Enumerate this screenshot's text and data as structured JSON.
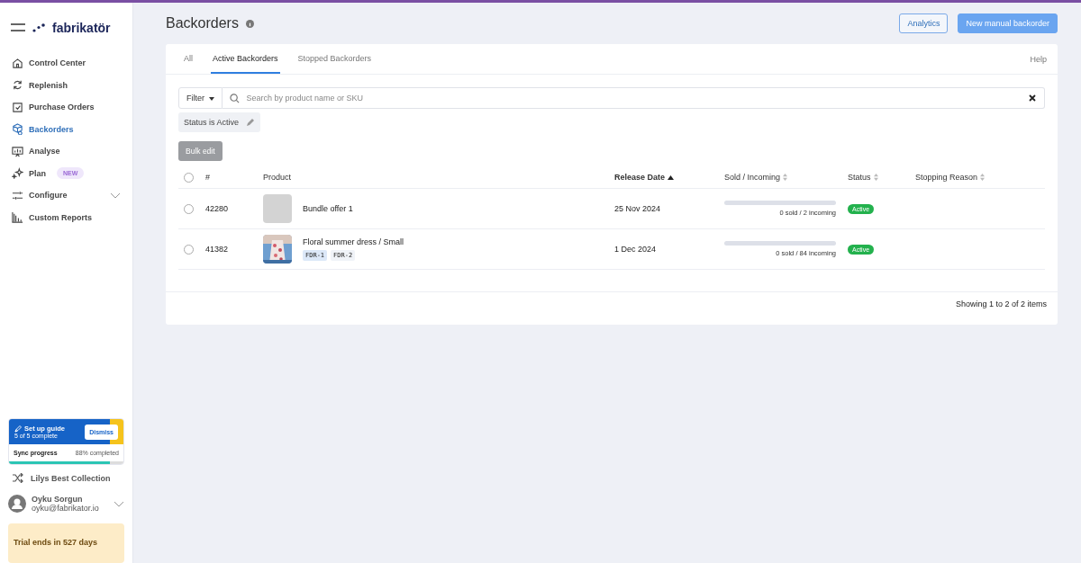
{
  "brand": {
    "name": "fabrikatör"
  },
  "nav": [
    {
      "label": "Control Center",
      "selected": false
    },
    {
      "label": "Replenish",
      "selected": false
    },
    {
      "label": "Purchase Orders",
      "selected": false
    },
    {
      "label": "Backorders",
      "selected": true
    },
    {
      "label": "Analyse",
      "selected": false
    },
    {
      "label": "Plan",
      "selected": false,
      "badge": "NEW"
    },
    {
      "label": "Configure",
      "selected": false,
      "expandable": true
    },
    {
      "label": "Custom Reports",
      "selected": false
    }
  ],
  "setup": {
    "title": "Set up guide",
    "subtitle": "5 of 5 complete",
    "dismiss": "Dismiss",
    "sync_label": "Sync progress",
    "sync_reading": "88% completed",
    "level": 0.88
  },
  "store": {
    "name": "Lilys Best Collection"
  },
  "user": {
    "name": "Oyku Sorgun",
    "email": "oyku@fabrikator.io"
  },
  "trial": {
    "text": "Trial ends in 527 days"
  },
  "page": {
    "title": "Backorders",
    "buttons": [
      {
        "label": "Analytics",
        "kind": "outline"
      },
      {
        "label": "New manual backorder",
        "kind": "primary"
      }
    ]
  },
  "tabs": [
    {
      "label": "All",
      "selected": false
    },
    {
      "label": "Active Backorders",
      "selected": true
    },
    {
      "label": "Stopped Backorders",
      "selected": false
    }
  ],
  "help": "Help",
  "filter": {
    "label": "Filter",
    "placeholder": "Search by product name or SKU",
    "chips": [
      "Status is Active"
    ]
  },
  "bulk_edit": {
    "label": "Bulk edit",
    "disabled": true
  },
  "table": {
    "all_checked": false,
    "columns": [
      {
        "label": "#",
        "kind": "plain"
      },
      {
        "label": "Product",
        "kind": "plain"
      },
      {
        "label": "Release Date",
        "kind": "sorted"
      },
      {
        "label": "Sold / Incoming",
        "kind": "sortable"
      },
      {
        "label": "Status",
        "kind": "sortable"
      },
      {
        "label": "Stopping Reason",
        "kind": "sortable"
      }
    ],
    "rows": [
      {
        "checked": false,
        "id": "42280",
        "kind": "placeholder",
        "product": "Bundle offer 1",
        "skus": [],
        "date": "25 Nov 2024",
        "level": 0,
        "reading": "0 sold / 2 incoming",
        "status": "Active"
      },
      {
        "checked": false,
        "id": "41382",
        "kind": "picture",
        "product": "Floral summer dress / Small",
        "skus": [
          {
            "label": "FDR-1",
            "selected": true
          },
          {
            "label": "FDR-2",
            "selected": false
          }
        ],
        "date": "1 Dec 2024",
        "level": 0,
        "reading": "0 sold / 84 incoming",
        "status": "Active"
      }
    ]
  },
  "footer": "Showing 1 to 2 of 2 items"
}
